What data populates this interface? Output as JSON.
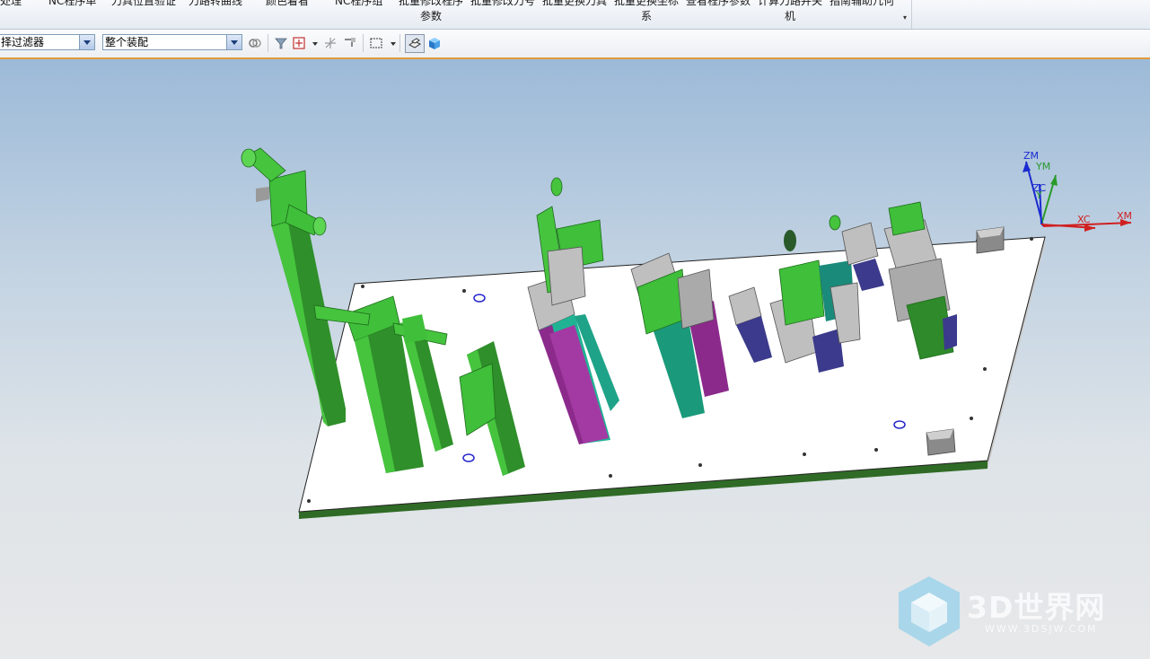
{
  "ribbon": {
    "items": [
      {
        "label": "处理"
      },
      {
        "label": "NC程序单"
      },
      {
        "label": "刀具位置验证"
      },
      {
        "label": "刀路转曲线"
      },
      {
        "label": "颜色着看"
      },
      {
        "label": "NC程序组"
      },
      {
        "label": "批量修改程序",
        "label2": "参数"
      },
      {
        "label": "批量修改刀号"
      },
      {
        "label": "批量更换刀具"
      },
      {
        "label": "批量更换坐标",
        "label2": "系"
      },
      {
        "label": "查看程序参数"
      },
      {
        "label": "计算刀路并关",
        "label2": "机"
      },
      {
        "label": "指南辅助几何"
      }
    ]
  },
  "toolbar": {
    "selection_filter": "择过滤器",
    "assembly_scope": "整个装配"
  },
  "viewport": {
    "axes": {
      "zm": "ZM",
      "ym": "YM",
      "zc": "ZC",
      "yc": "Y",
      "xc": "XC",
      "xm": "XM"
    },
    "colors": {
      "green": "#3fbf3a",
      "dark_green": "#1e6b1c",
      "teal": "#1fb394",
      "purple": "#8c2a8c",
      "navy": "#3b3a8c",
      "grey": "#b9b9b9",
      "plate": "#ffffff"
    }
  },
  "watermark": {
    "text": "3D世界网",
    "sub": "WWW.3DSJW.COM"
  }
}
